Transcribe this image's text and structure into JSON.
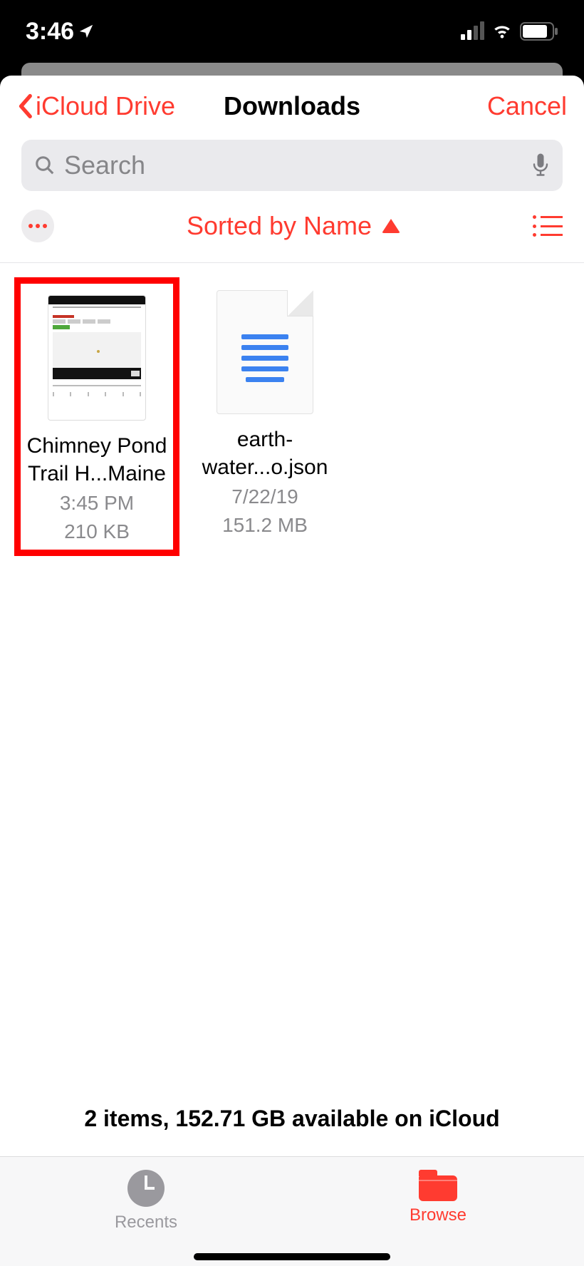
{
  "statusbar": {
    "time": "3:46"
  },
  "nav": {
    "back": "iCloud Drive",
    "title": "Downloads",
    "cancel": "Cancel"
  },
  "search": {
    "placeholder": "Search"
  },
  "sort": {
    "label": "Sorted by Name"
  },
  "files": [
    {
      "name": "Chimney Pond Trail H...Maine",
      "date": "3:45 PM",
      "size": "210 KB"
    },
    {
      "name": "earth-water...o.json",
      "date": "7/22/19",
      "size": "151.2 MB"
    }
  ],
  "summary": "2 items, 152.71 GB available on iCloud",
  "tabs": {
    "recents": "Recents",
    "browse": "Browse"
  }
}
